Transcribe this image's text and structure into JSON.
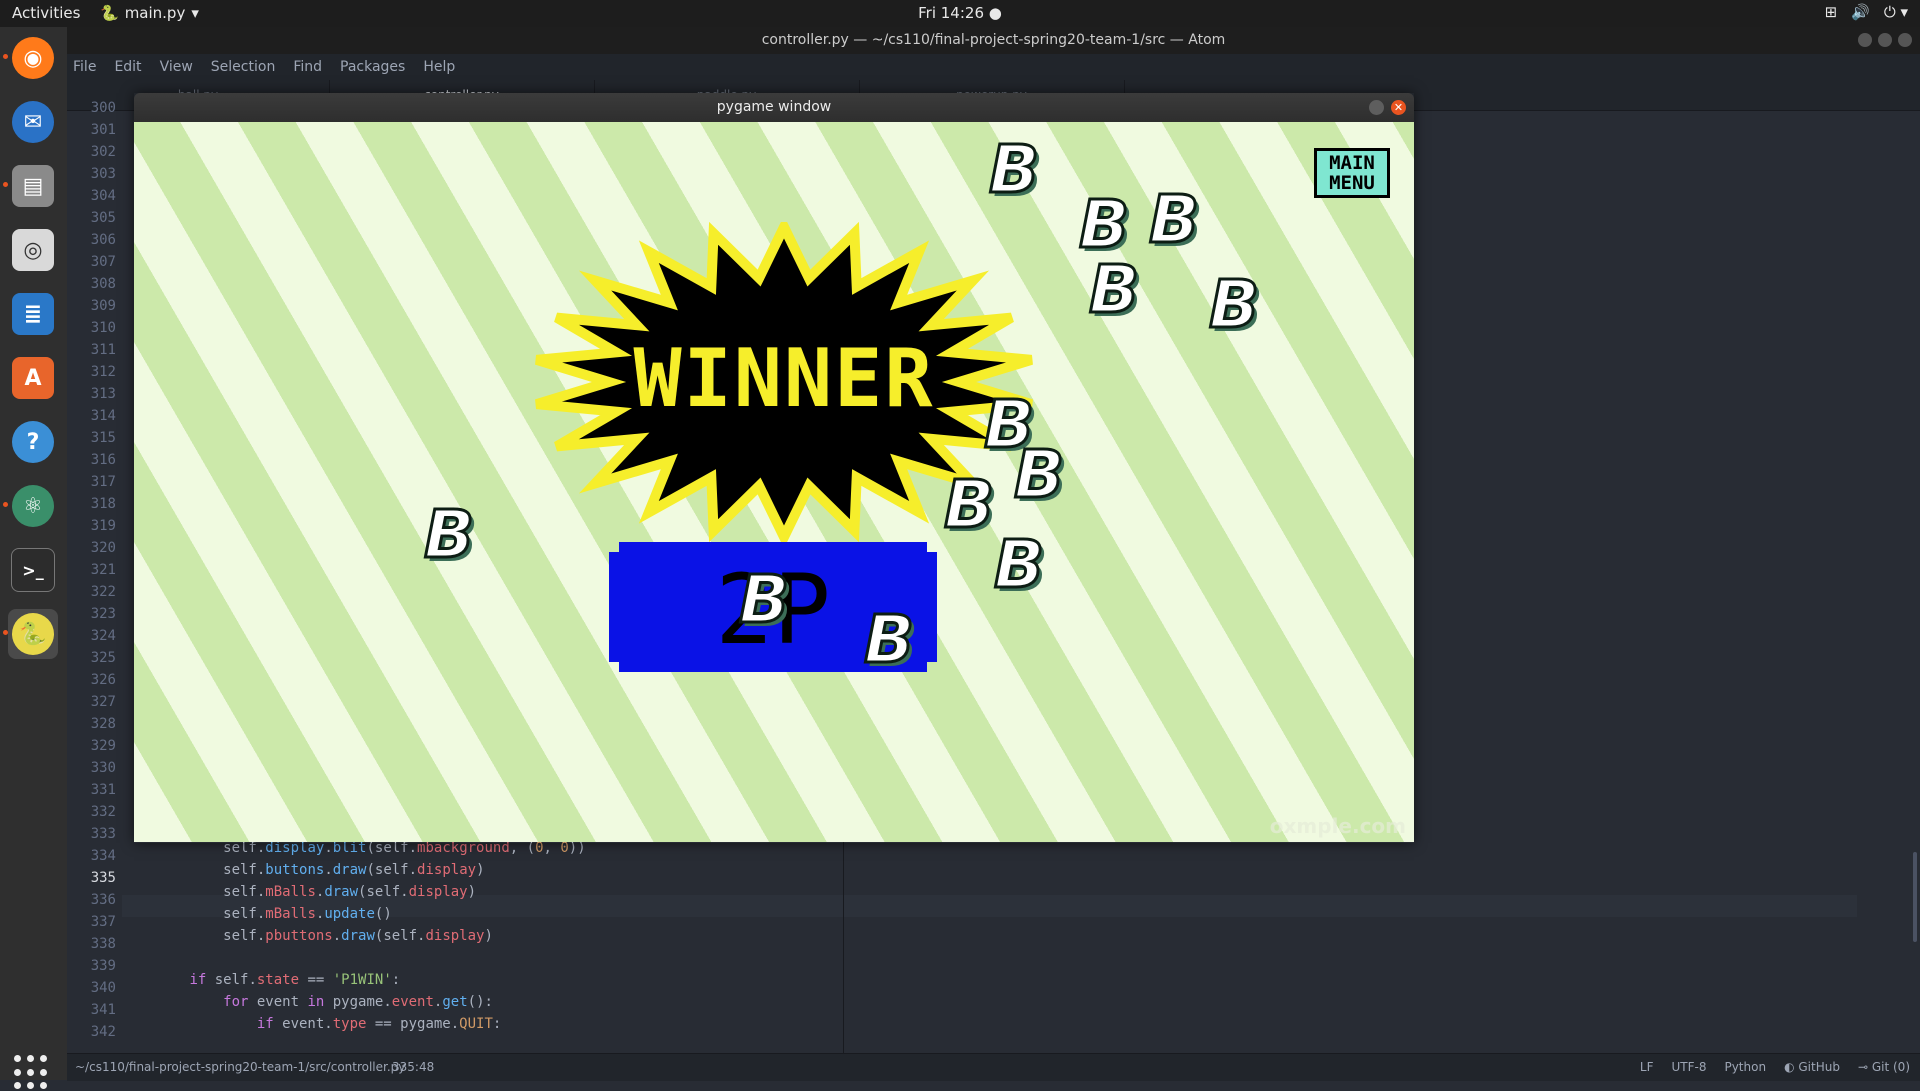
{
  "topbar": {
    "activities": "Activities",
    "app_menu": "main.py",
    "clock": "Fri 14:26"
  },
  "atom": {
    "title": "controller.py — ~/cs110/final-project-spring20-team-1/src — Atom",
    "menu": [
      "File",
      "Edit",
      "View",
      "Selection",
      "Find",
      "Packages",
      "Help"
    ],
    "tabs": [
      "ball.py",
      "controller.py",
      "paddle.py",
      "powerup.py"
    ],
    "line_numbers": [
      "300",
      "301",
      "302",
      "303",
      "304",
      "305",
      "306",
      "307",
      "308",
      "309",
      "310",
      "311",
      "312",
      "313",
      "314",
      "315",
      "316",
      "317",
      "318",
      "319",
      "320",
      "321",
      "322",
      "323",
      "324",
      "325",
      "326",
      "327",
      "328",
      "329",
      "330",
      "331",
      "332",
      "333",
      "334",
      "335",
      "336",
      "337",
      "338",
      "339",
      "340",
      "341",
      "342"
    ],
    "code_lines": {
      "l334": "            self.display.blit(self.mbackground, (0, 0))",
      "l335": "            self.buttons.draw(self.display)",
      "l336": "            self.mBalls.draw(self.display)",
      "l337": "            self.mBalls.update()",
      "l338": "            self.pbuttons.draw(self.display)",
      "l340": "        if self.state == 'P1WIN':",
      "l341": "            for event in pygame.event.get():",
      "l342": "                if event.type == pygame.QUIT:"
    },
    "status": {
      "path": "~/cs110/final-project-spring20-team-1/src/controller.py",
      "cursor": "335:48",
      "eol": "LF",
      "encoding": "UTF-8",
      "grammar": "Python",
      "github": "GitHub",
      "git": "Git (0)"
    }
  },
  "pygame": {
    "title": "pygame window",
    "winner_text": "WINNER",
    "player_button": "2P",
    "main_menu": "MAIN MENU",
    "ball_letter": "B",
    "watermark": "oxmple.com"
  }
}
